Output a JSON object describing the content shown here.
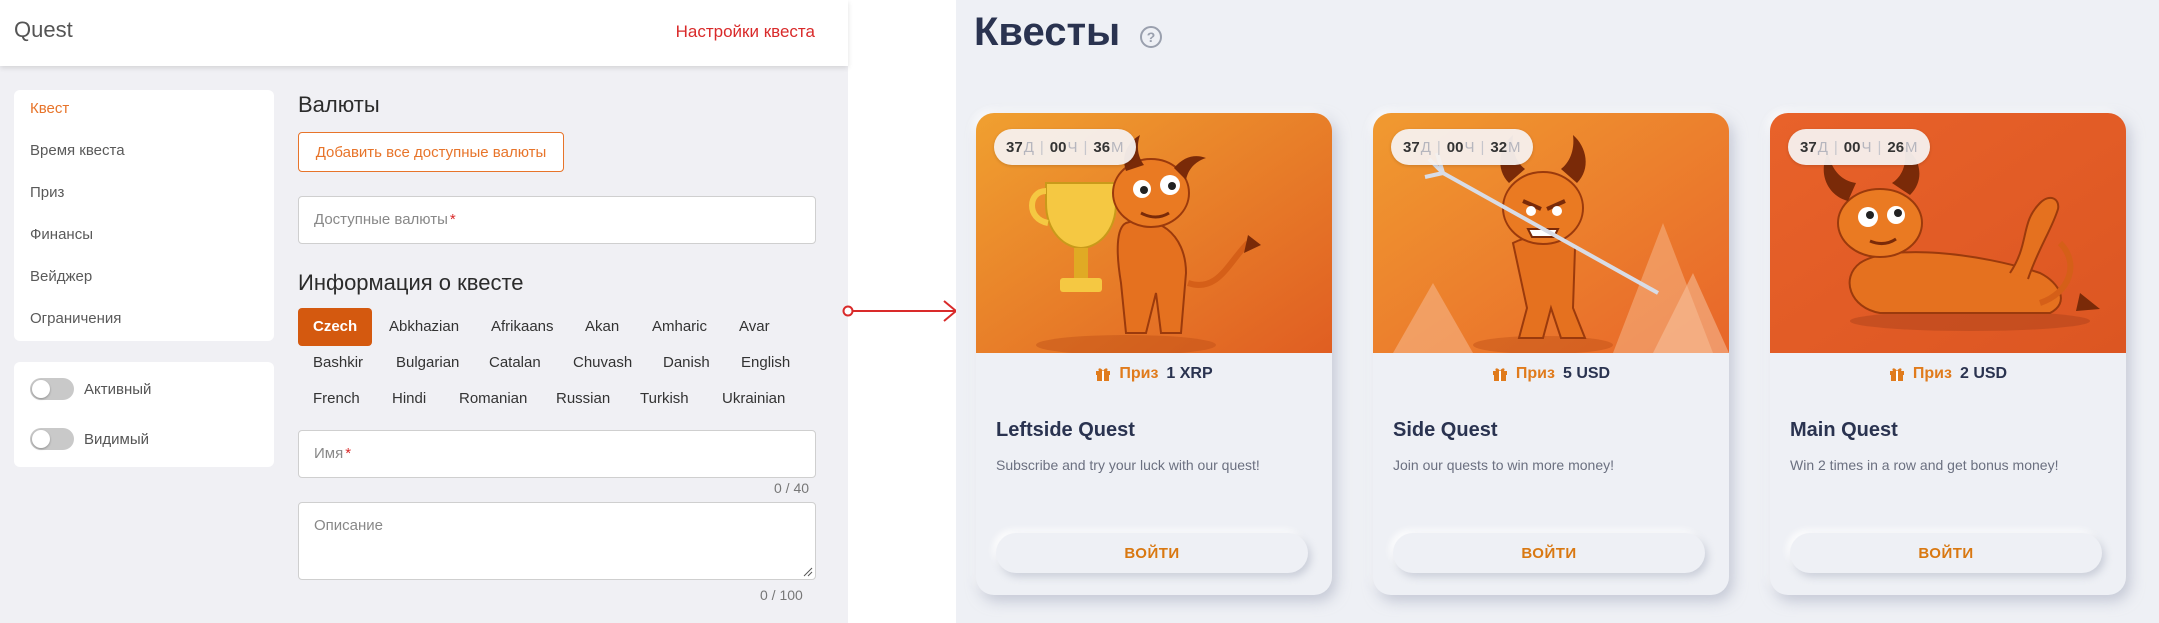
{
  "left": {
    "app_title": "Quest",
    "settings_link": "Настройки квеста",
    "nav": [
      "Квест",
      "Время квеста",
      "Приз",
      "Финансы",
      "Вейджер",
      "Ограничения"
    ],
    "toggles": [
      "Активный",
      "Видимый"
    ],
    "currencies": {
      "title": "Валюты",
      "add_all": "Добавить все доступные валюты",
      "available_placeholder": "Доступные валюты",
      "required_mark": "*"
    },
    "info": {
      "title": "Информация о квесте",
      "languages": [
        "Czech",
        "Abkhazian",
        "Afrikaans",
        "Akan",
        "Amharic",
        "Avar",
        "Bashkir",
        "Bulgarian",
        "Catalan",
        "Chuvash",
        "Danish",
        "English",
        "French",
        "Hindi",
        "Romanian",
        "Russian",
        "Turkish",
        "Ukrainian"
      ],
      "selected_language": "Czech",
      "name_placeholder": "Имя",
      "name_counter": "0 / 40",
      "description_placeholder": "Описание",
      "description_counter": "0 / 100"
    }
  },
  "right": {
    "heading": "Квесты",
    "help_symbol": "?",
    "prize_label": "Приз",
    "enter_label": "ВОЙТИ",
    "timer_units": {
      "days": "Д",
      "hours": "Ч",
      "minutes": "М"
    },
    "cards": [
      {
        "title": "Leftside Quest",
        "description": "Subscribe and try your luck with our quest!",
        "prize": "1 XRP",
        "days": "37",
        "hours": "00",
        "minutes": "36",
        "illustration": "devil-with-trophy"
      },
      {
        "title": "Side Quest",
        "description": "Join our quests to win more money!",
        "prize": "5 USD",
        "days": "37",
        "hours": "00",
        "minutes": "32",
        "illustration": "devil-with-trident"
      },
      {
        "title": "Main Quest",
        "description": "Win 2 times in a row and get bonus money!",
        "prize": "2 USD",
        "days": "37",
        "hours": "00",
        "minutes": "26",
        "illustration": "devil-lying"
      }
    ]
  },
  "colors": {
    "accent_orange": "#e7742a",
    "selected_chip": "#d4590f",
    "link_red": "#d92a2a",
    "arrow_red": "#d92a2a",
    "heading_navy": "#2a3350",
    "prize_orange": "#e07b1c"
  }
}
